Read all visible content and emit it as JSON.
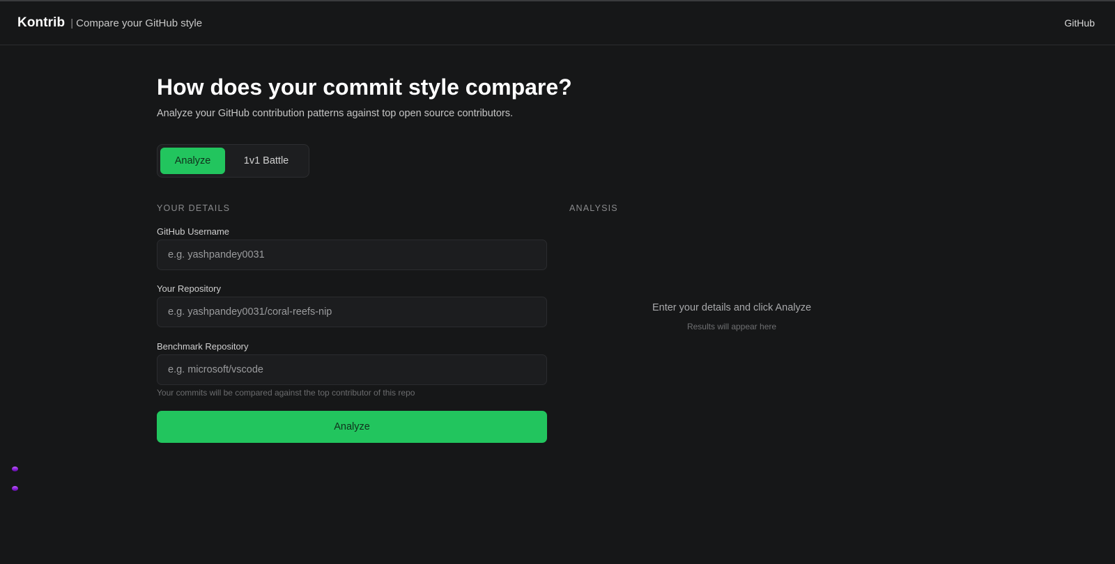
{
  "header": {
    "brand": "Kontrib",
    "separator": "|",
    "tagline": "Compare your GitHub style",
    "github_link": "GitHub"
  },
  "hero": {
    "title": "How does your commit style compare?",
    "subtitle": "Analyze your GitHub contribution patterns against top open source contributors."
  },
  "mode_switch": {
    "active": "Analyze",
    "options": [
      "Analyze",
      "1v1 Battle"
    ]
  },
  "details": {
    "section_label": "YOUR DETAILS",
    "username": {
      "label": "GitHub Username",
      "placeholder": "e.g. yashpandey0031",
      "value": ""
    },
    "repository": {
      "label": "Your Repository",
      "placeholder": "e.g. yashpandey0031/coral-reefs-nip",
      "value": ""
    },
    "benchmark": {
      "label": "Benchmark Repository",
      "placeholder": "e.g. microsoft/vscode",
      "value": ""
    },
    "hint": "Your commits will be compared against the top contributor of this repo",
    "submit_label": "Analyze"
  },
  "analysis": {
    "section_label": "ANALYSIS",
    "empty_title": "Enter your details and click Analyze",
    "empty_subtitle": "Results will appear here"
  },
  "colors": {
    "background": "#161718",
    "accent": "#22c55e",
    "input_bg": "#1c1d1f",
    "floating_dots": "#8a1fd6"
  },
  "icons": [
    "floating-dot-icon",
    "floating-dot-icon"
  ]
}
